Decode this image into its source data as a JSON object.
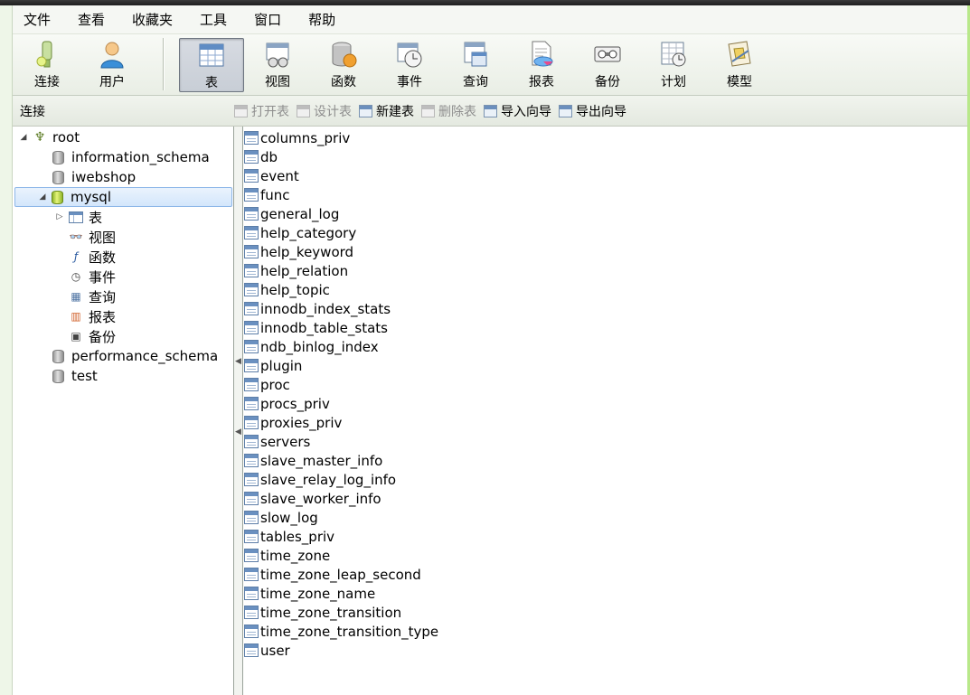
{
  "menu": [
    "文件",
    "查看",
    "收藏夹",
    "工具",
    "窗口",
    "帮助"
  ],
  "toolbar": {
    "connect": "连接",
    "user": "用户",
    "table": "表",
    "view": "视图",
    "function": "函数",
    "event": "事件",
    "query": "查询",
    "report": "报表",
    "backup": "备份",
    "schedule": "计划",
    "model": "模型"
  },
  "subbar": {
    "title": "连接",
    "open_table": "打开表",
    "design_table": "设计表",
    "new_table": "新建表",
    "delete_table": "删除表",
    "import_wizard": "导入向导",
    "export_wizard": "导出向导"
  },
  "tree": {
    "root": "root",
    "databases": [
      "information_schema",
      "iwebshop",
      "mysql",
      "performance_schema",
      "test"
    ],
    "mysql_children": [
      "表",
      "视图",
      "函数",
      "事件",
      "查询",
      "报表",
      "备份"
    ]
  },
  "tables": [
    "columns_priv",
    "db",
    "event",
    "func",
    "general_log",
    "help_category",
    "help_keyword",
    "help_relation",
    "help_topic",
    "innodb_index_stats",
    "innodb_table_stats",
    "ndb_binlog_index",
    "plugin",
    "proc",
    "procs_priv",
    "proxies_priv",
    "servers",
    "slave_master_info",
    "slave_relay_log_info",
    "slave_worker_info",
    "slow_log",
    "tables_priv",
    "time_zone",
    "time_zone_leap_second",
    "time_zone_name",
    "time_zone_transition",
    "time_zone_transition_type",
    "user"
  ]
}
